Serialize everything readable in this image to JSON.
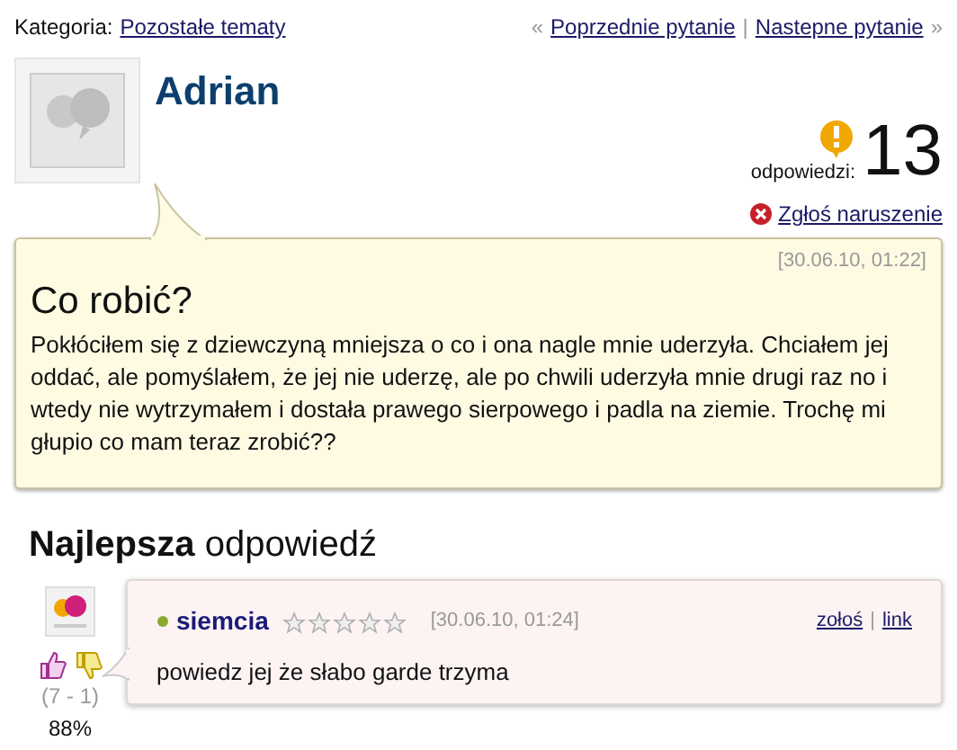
{
  "breadcrumb": {
    "label": "Kategoria:",
    "category": "Pozostałe tematy"
  },
  "navigation": {
    "prev_arrow": "«",
    "prev": "Poprzednie pytanie",
    "separator": "|",
    "next": "Nastepne pytanie",
    "next_arrow": "»"
  },
  "question": {
    "author": "Adrian",
    "answers_label": "odpowiedzi:",
    "answers_count": "13",
    "report": "Zgłoś naruszenie",
    "date": "[30.06.10, 01:22]",
    "title": "Co robić?",
    "body": "Pokłóciłem się z dziewczyną mniejsza o co i ona nagle mnie uderzyła. Chciałem jej oddać, ale pomyślałem, że jej nie uderzę, ale po chwili uderzyła mnie drugi raz no i wtedy nie wytrzymałem i dostała prawego sierpowego i padla na ziemie. Trochę mi głupio co mam teraz zrobić??"
  },
  "best_answer": {
    "heading": "**Najlepsza** odpowiedź",
    "author": "siemcia",
    "online": true,
    "stars": 0,
    "date": "[30.06.10, 01:24]",
    "report": "zołoś",
    "separator": "|",
    "link": "link",
    "body": "powiedz jej że słabo garde trzyma",
    "votes": "(7 - 1)",
    "percent": "88%"
  }
}
